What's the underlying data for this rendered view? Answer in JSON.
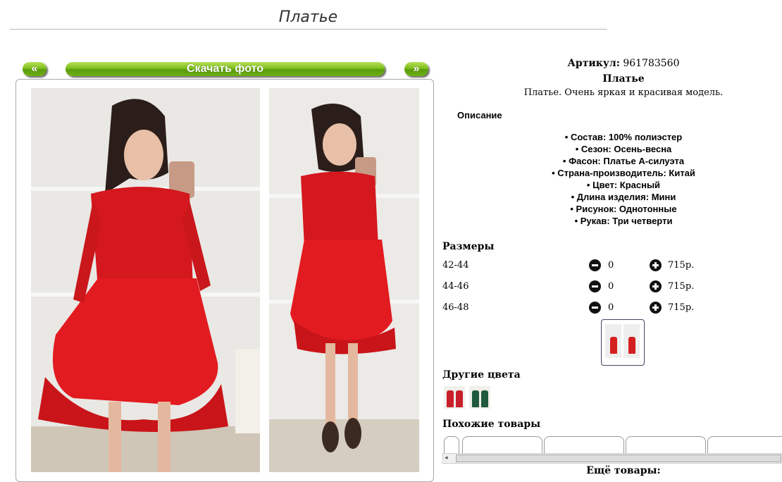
{
  "page": {
    "title": "Платье"
  },
  "gallery": {
    "prev_label": "«",
    "download_label": "Скачать фото",
    "next_label": "»"
  },
  "product": {
    "artikul_label": "Артикул:",
    "artikul_value": "961783560",
    "name": "Платье",
    "short_description": "Платье. Очень яркая и красивая модель.",
    "description_heading": "Описание",
    "features": [
      "• Состав: 100% полиэстер",
      "• Сезон: Осень-весна",
      "• Фасон: Платье А-силуэта",
      "• Страна-производитель: Китай",
      "• Цвет: Красный",
      "• Длина изделия: Мини",
      "• Рисунок: Однотонные",
      "• Рукав: Три четверти"
    ]
  },
  "sizes": {
    "heading": "Размеры",
    "rows": [
      {
        "label": "42-44",
        "qty": "0",
        "price": "715р."
      },
      {
        "label": "44-46",
        "qty": "0",
        "price": "715р."
      },
      {
        "label": "46-48",
        "qty": "0",
        "price": "715р."
      }
    ]
  },
  "other_colors": {
    "heading": "Другие цвета",
    "colors": [
      "#c81f2a",
      "#1f5a3d"
    ]
  },
  "similar": {
    "heading": "Похожие товары",
    "more_label": "Ещё товары:"
  },
  "colors": {
    "accent_green": "#7fbf1c",
    "dress_red": "#d41f1f"
  }
}
